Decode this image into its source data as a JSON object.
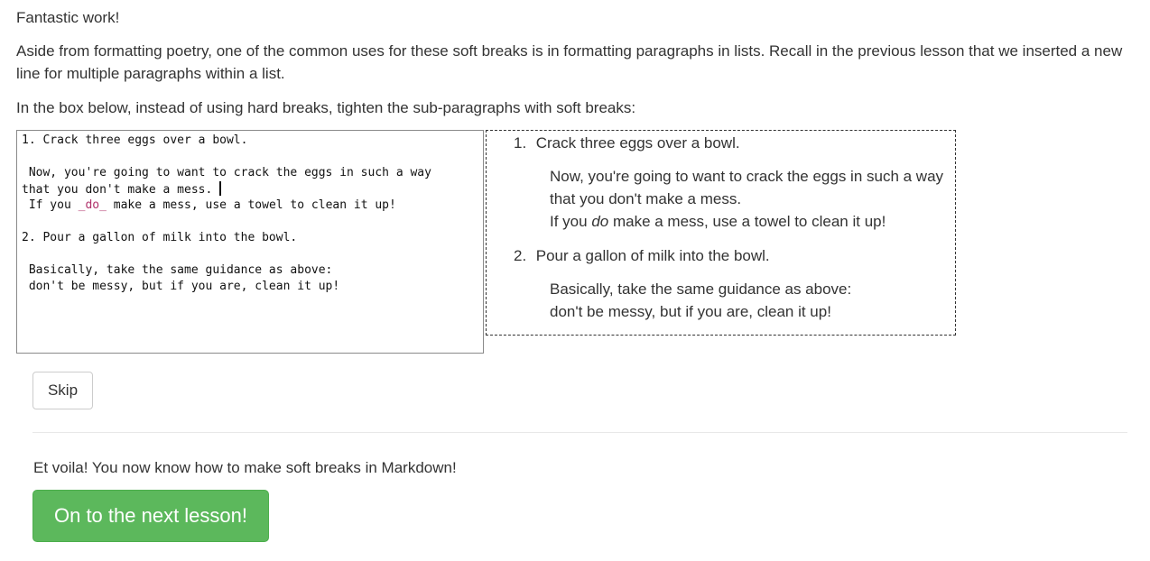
{
  "intro": {
    "praise": "Fantastic work!",
    "paragraph": "Aside from formatting poetry, one of the common uses for these soft breaks is in formatting paragraphs in lists. Recall in the previous lesson that we inserted a new line for multiple paragraphs within a list.",
    "instruction": "In the box below, instead of using hard breaks, tighten the sub-paragraphs with soft breaks:"
  },
  "editor": {
    "line1": "1. Crack three eggs over a bowl.",
    "line2": "",
    "line3": " Now, you're going to want to crack the eggs in such a way",
    "line4": "that you don't make a mess.",
    "line5_pre": " If you ",
    "line5_em": "_do_",
    "line5_post": " make a mess, use a towel to clean it up!",
    "line6": "",
    "line7": "2. Pour a gallon of milk into the bowl.",
    "line8": "",
    "line9": " Basically, take the same guidance as above:",
    "line10": " don't be messy, but if you are, clean it up!"
  },
  "preview": {
    "item1_num": "1.",
    "item1_text": "Crack three eggs over a bowl.",
    "item1_sub_line1": "Now, you're going to want to crack the eggs in such a way that you don't make a mess.",
    "item1_sub_line2_pre": "If you ",
    "item1_sub_line2_em": "do",
    "item1_sub_line2_post": " make a mess, use a towel to clean it up!",
    "item2_num": "2.",
    "item2_text": "Pour a gallon of milk into the bowl.",
    "item2_sub_line1": "Basically, take the same guidance as above:",
    "item2_sub_line2": "don't be messy, but if you are, clean it up!"
  },
  "buttons": {
    "skip": "Skip",
    "next": "On to the next lesson!"
  },
  "completion": {
    "text": "Et voila! You now know how to make soft breaks in Markdown!"
  },
  "colors": {
    "success": "#5cb85c",
    "markdown_emphasis": "#b0306a"
  }
}
